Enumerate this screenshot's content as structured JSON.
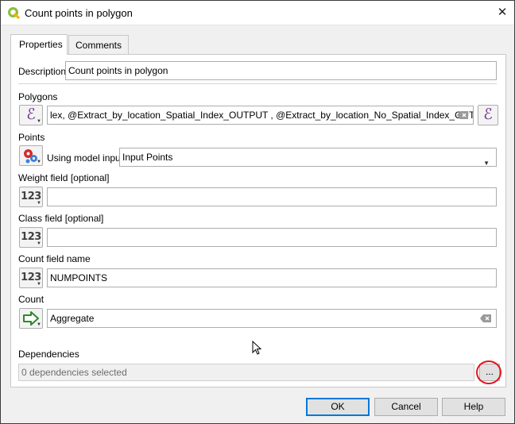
{
  "window": {
    "title": "Count points in polygon",
    "close_glyph": "✕"
  },
  "tabs": [
    {
      "label": "Properties"
    },
    {
      "label": "Comments"
    }
  ],
  "description": {
    "label": "Description",
    "value": "Count points in polygon"
  },
  "polygons": {
    "label": "Polygons",
    "value": "lex, @Extract_by_location_Spatial_Index_OUTPUT , @Extract_by_location_No_Spatial_Index_OUTPUT )",
    "icon": "expression-icon"
  },
  "points": {
    "label": "Points",
    "mode_label": "Using model input",
    "value": "Input Points",
    "icon": "model-input-icon"
  },
  "weight_field": {
    "label": "Weight field [optional]",
    "value": "",
    "icon_text": "123"
  },
  "class_field": {
    "label": "Class field [optional]",
    "value": "",
    "icon_text": "123"
  },
  "count_field_name": {
    "label": "Count field name",
    "value": "NUMPOINTS",
    "icon_text": "123"
  },
  "count": {
    "label": "Count",
    "value": "Aggregate",
    "icon": "output-arrow-icon"
  },
  "dependencies": {
    "label": "Dependencies",
    "value": "0 dependencies selected",
    "button_label": "..."
  },
  "buttons": {
    "ok": "OK",
    "cancel": "Cancel",
    "help": "Help"
  },
  "colors": {
    "accent": "#0078d7",
    "highlight": "#e3141d",
    "expression": "#6b2c8a"
  }
}
